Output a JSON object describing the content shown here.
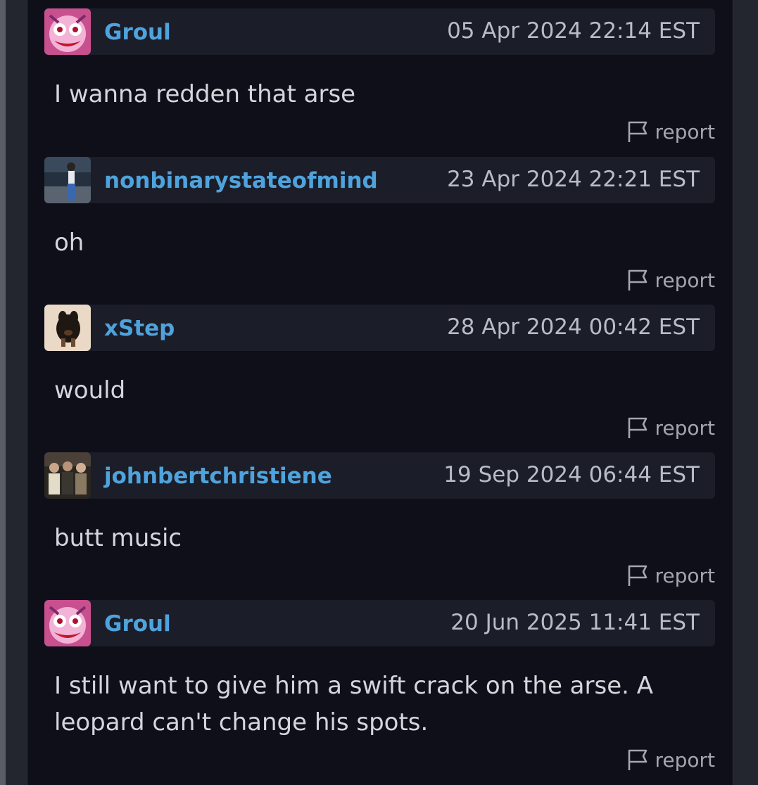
{
  "comments": [
    {
      "username": "Groul",
      "timestamp": "05 Apr 2024 22:14 EST",
      "body": "I wanna redden that arse",
      "avatar_icon": "pink-creature-avatar",
      "report_label": "report"
    },
    {
      "username": "nonbinarystateofmind",
      "timestamp": "23 Apr 2024 22:21 EST",
      "body": "oh",
      "avatar_icon": "lakeside-photo-avatar",
      "report_label": "report"
    },
    {
      "username": "xStep",
      "timestamp": "28 Apr 2024 00:42 EST",
      "body": "would",
      "avatar_icon": "dog-photo-avatar",
      "report_label": "report"
    },
    {
      "username": "johnbertchristiene",
      "timestamp": "19 Sep 2024 06:44 EST",
      "body": "butt music",
      "avatar_icon": "group-photo-avatar",
      "report_label": "report"
    },
    {
      "username": "Groul",
      "timestamp": "20 Jun 2025 11:41 EST",
      "body": "I still want to give him a swift crack on the arse. A leopard can't change his spots.",
      "avatar_icon": "pink-creature-avatar",
      "report_label": "report"
    }
  ],
  "colors": {
    "background": "#0f0f1a",
    "header_bg": "#1b1d28",
    "username": "#4fa3dd",
    "text": "#d4d6dc",
    "muted": "#a2a6b0"
  }
}
